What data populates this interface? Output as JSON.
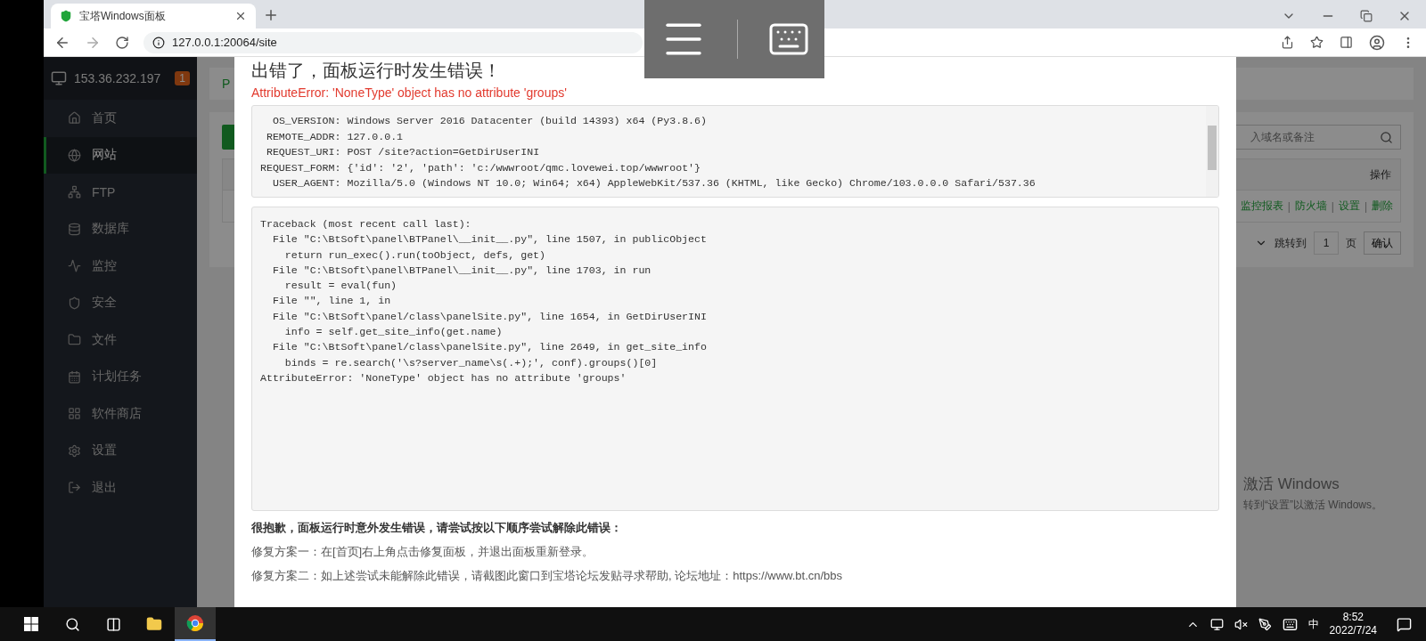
{
  "browser": {
    "tab_title": "宝塔Windows面板",
    "url": "127.0.0.1:20064/site"
  },
  "sidebar": {
    "host": "153.36.232.197",
    "badge": "1",
    "items": [
      {
        "label": "首页",
        "selected": false
      },
      {
        "label": "网站",
        "selected": true
      },
      {
        "label": "FTP",
        "selected": false
      },
      {
        "label": "数据库",
        "selected": false
      },
      {
        "label": "监控",
        "selected": false
      },
      {
        "label": "安全",
        "selected": false
      },
      {
        "label": "文件",
        "selected": false
      },
      {
        "label": "计划任务",
        "selected": false
      },
      {
        "label": "软件商店",
        "selected": false
      },
      {
        "label": "设置",
        "selected": false
      },
      {
        "label": "退出",
        "selected": false
      }
    ]
  },
  "page": {
    "header_text": "P",
    "search_placeholder": "入域名或备注",
    "table_header": "操作",
    "row_actions": [
      "监控报表",
      "防火墙",
      "设置",
      "删除"
    ],
    "separator": "|",
    "pagination": {
      "jump_label": "跳转到",
      "page": "1",
      "page_unit": "页",
      "confirm": "确认"
    }
  },
  "dialog": {
    "title": "出错了，面板运行时发生错误！",
    "error": "AttributeError: 'NoneType' object has no attribute 'groups'",
    "env": [
      {
        "key": "OS_VERSION:",
        "value": "Windows Server 2016 Datacenter (build 14393) x64 (Py3.8.6)"
      },
      {
        "key": "REMOTE_ADDR:",
        "value": "127.0.0.1"
      },
      {
        "key": "REQUEST_URI:",
        "value": "POST /site?action=GetDirUserINI"
      },
      {
        "key": "REQUEST_FORM:",
        "value": "{'id': '2', 'path': 'c:/wwwroot/qmc.lovewei.top/wwwroot'}"
      },
      {
        "key": "USER_AGENT:",
        "value": "Mozilla/5.0 (Windows NT 10.0; Win64; x64) AppleWebKit/537.36 (KHTML, like Gecko) Chrome/103.0.0.0 Safari/537.36"
      }
    ],
    "traceback": [
      "Traceback (most recent call last):",
      "  File \"C:\\BtSoft\\panel\\BTPanel\\__init__.py\", line 1507, in publicObject",
      "    return run_exec().run(toObject, defs, get)",
      "  File \"C:\\BtSoft\\panel\\BTPanel\\__init__.py\", line 1703, in run",
      "    result = eval(fun)",
      "  File \"\", line 1, in",
      "  File \"C:\\BtSoft\\panel/class\\panelSite.py\", line 1654, in GetDirUserINI",
      "    info = self.get_site_info(get.name)",
      "  File \"C:\\BtSoft\\panel/class\\panelSite.py\", line 2649, in get_site_info",
      "    binds = re.search('\\s?server_name\\s(.+);', conf).groups()[0]",
      "AttributeError: 'NoneType' object has no attribute 'groups'"
    ],
    "help_title": "很抱歉，面板运行时意外发生错误，请尝试按以下顺序尝试解除此错误：",
    "fixes": [
      "修复方案一：在[首页]右上角点击修复面板，并退出面板重新登录。",
      "修复方案二：如上述尝试未能解除此错误，请截图此窗口到宝塔论坛发贴寻求帮助, 论坛地址：https://www.bt.cn/bbs"
    ]
  },
  "activation": {
    "title": "激活 Windows",
    "hint": "转到“设置”以激活 Windows。"
  },
  "taskbar": {
    "ime": "中",
    "time": "8:52",
    "date": "2022/7/24"
  }
}
